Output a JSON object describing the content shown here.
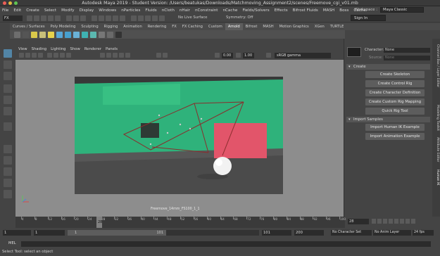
{
  "window": {
    "title": "Autodesk Maya 2019 - Student Version: /Users/beatukas/Downloads/Matchmoving_Assignment2/scenes/Freemove_cgi_v01.mb"
  },
  "menu": [
    "File",
    "Edit",
    "Create",
    "Select",
    "Modify",
    "Display",
    "Windows",
    "nParticles",
    "Fluids",
    "nCloth",
    "nHair",
    "nConstraint",
    "nCache",
    "Fields/Solvers",
    "Effects",
    "Bifrost Fluids",
    "MASH",
    "Boss",
    "Cache"
  ],
  "workspace": {
    "label": "Workspace :",
    "value": "Maya Classic"
  },
  "toolbar": {
    "menuset": "FX",
    "live_surface": "No Live Surface",
    "symmetry": "Symmetry: Off",
    "sign_in": "Sign In"
  },
  "shelf_tabs": [
    "Curves / Surfaces",
    "Poly Modeling",
    "Sculpting",
    "Rigging",
    "Animation",
    "Rendering",
    "FX",
    "FX Caching",
    "Custom",
    "Arnold",
    "Bifrost",
    "MASH",
    "Motion Graphics",
    "XGen",
    "TURTLE"
  ],
  "shelf_active": "Arnold",
  "panel_menu": [
    "View",
    "Shading",
    "Lighting",
    "Show",
    "Renderer",
    "Panels"
  ],
  "viewport": {
    "gamma_value1": "0.00",
    "gamma_value2": "1.00",
    "color_space": "sRGB gamma",
    "camera_label": "Freemove_14mm_FS100_1_1"
  },
  "hik": {
    "character_label": "Character:",
    "character_value": "None",
    "source_label": "Source:",
    "source_value": "None",
    "create_section": "Create",
    "buttons_create": [
      "Create Skeleton",
      "Create Control Rig",
      "Create Character Definition",
      "Create Custom Rig Mapping",
      "Quick Rig Tool"
    ],
    "import_section": "Import Samples",
    "buttons_import": [
      "Import Human IK Example",
      "Import Animation Example"
    ]
  },
  "side_tabs": [
    "Channel Box / Layer Editor",
    "Modeling Toolkit",
    "Attribute Editor",
    "Human IK"
  ],
  "timeline": {
    "ticks": [
      "4",
      "8",
      "12",
      "16",
      "20",
      "24",
      "28",
      "32",
      "36",
      "40",
      "44",
      "48",
      "52",
      "56",
      "60",
      "64",
      "68",
      "72",
      "76",
      "80",
      "84",
      "88",
      "92",
      "96",
      "100"
    ],
    "current_frame": "28",
    "current_frame_box": "28"
  },
  "range": {
    "start": "1",
    "anim_start": "1",
    "slider_left": "1",
    "slider_right": "101",
    "anim_end": "101",
    "end": "200",
    "character_set": "No Character Set",
    "anim_layer": "No Anim Layer",
    "fps": "24 fps"
  },
  "mel": {
    "label": "MEL"
  },
  "status": {
    "text": "Select Tool: select an object"
  },
  "colors": {
    "greenscreen": "#2fb27b",
    "red_panel": "#e2556a",
    "accent_blue": "#2ea8de"
  }
}
